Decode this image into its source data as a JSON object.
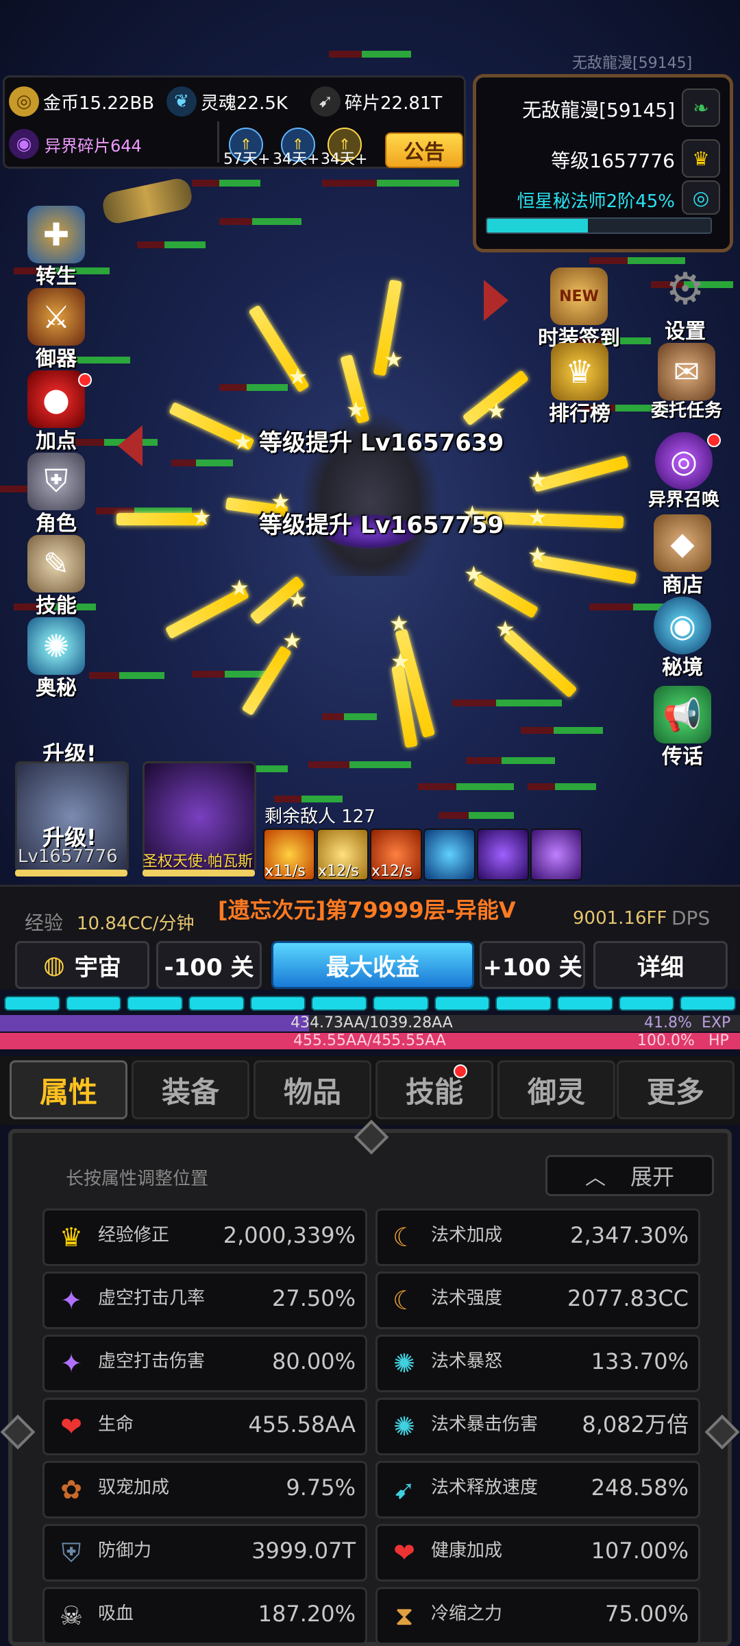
{
  "watermark_name": "无敌龍漫[59145]",
  "currency": {
    "gold": "金币15.22BB",
    "soul": "灵魂22.5K",
    "fragment": "碎片22.81T",
    "otherworld_fragment": "异界碎片644",
    "announce": "公告",
    "buff_days": [
      "57天+",
      "34天+",
      "34天+"
    ]
  },
  "player": {
    "name": "无敌龍漫[59145]",
    "level": "等级1657776",
    "rank": "恒星秘法师2阶45%",
    "rank_progress": 0.45
  },
  "left_menu": [
    "转生",
    "御器",
    "加点",
    "角色",
    "技能",
    "奥秘"
  ],
  "upgrade_texts": [
    "升级!",
    "升级!"
  ],
  "right_menu": [
    "时装签到",
    "设置",
    "排行榜",
    "委托任务",
    "异界召唤",
    "商店",
    "秘境",
    "传话"
  ],
  "new_badge": "NEW",
  "battle": {
    "levelups": [
      "等级提升 Lv1657639",
      "等级提升 Lv1657759"
    ],
    "enemies_left": "剩余敌人 127"
  },
  "heroes": {
    "main_level": "Lv1657776",
    "companion": "圣权天使·帕瓦斯"
  },
  "skill_rates": [
    "x11/s",
    "x12/s",
    "x12/s"
  ],
  "stage": {
    "exp_label": "经验",
    "exp_rate": "10.84CC/分钟",
    "title": "[遗忘次元]第79999层-异能V",
    "dps_value": "9001.16FF",
    "dps_unit": "DPS",
    "universe": "宇宙",
    "minus": "-100 关",
    "max": "最大收益",
    "plus": "+100 关",
    "detail": "详细"
  },
  "bars": {
    "exp_text": "434.73AA/1039.28AA",
    "exp_pct": "41.8%",
    "exp_label": "EXP",
    "exp_fraction": 0.418,
    "hp_text": "455.55AA/455.55AA",
    "hp_pct": "100.0%",
    "hp_label": "HP",
    "hp_fraction": 1.0
  },
  "tabs": [
    "属性",
    "装备",
    "物品",
    "技能",
    "御灵",
    "更多"
  ],
  "attr_panel": {
    "hint": "长按属性调整位置",
    "expand": "展开",
    "left": [
      {
        "name": "经验修正",
        "value": "2,000,339%",
        "icon": "crown-icon"
      },
      {
        "name": "虚空打击几率",
        "value": "27.50%",
        "icon": "void-strike-icon"
      },
      {
        "name": "虚空打击伤害",
        "value": "80.00%",
        "icon": "void-damage-icon"
      },
      {
        "name": "生命",
        "value": "455.58AA",
        "icon": "heart-icon"
      },
      {
        "name": "驭宠加成",
        "value": "9.75%",
        "icon": "paw-icon"
      },
      {
        "name": "防御力",
        "value": "3999.07T",
        "icon": "shield-icon"
      },
      {
        "name": "吸血",
        "value": "187.20%",
        "icon": "skull-icon"
      }
    ],
    "right": [
      {
        "name": "法术加成",
        "value": "2,347.30%",
        "icon": "spell-boost-icon"
      },
      {
        "name": "法术强度",
        "value": "2077.83CC",
        "icon": "spell-power-icon"
      },
      {
        "name": "法术暴怒",
        "value": "133.70%",
        "icon": "spell-fury-icon"
      },
      {
        "name": "法术暴击伤害",
        "value": "8,082万倍",
        "icon": "spell-crit-icon"
      },
      {
        "name": "法术释放速度",
        "value": "248.58%",
        "icon": "cast-speed-icon"
      },
      {
        "name": "健康加成",
        "value": "107.00%",
        "icon": "health-boost-icon"
      },
      {
        "name": "冷缩之力",
        "value": "75.00%",
        "icon": "cooldown-icon"
      }
    ]
  }
}
